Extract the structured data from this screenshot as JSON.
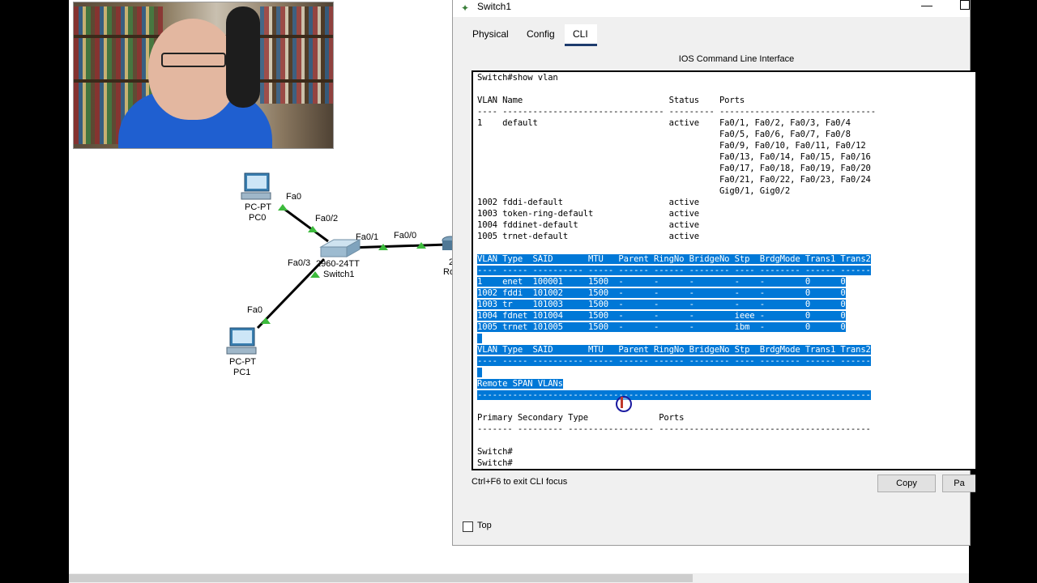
{
  "topology": {
    "pc0": {
      "type": "PC-PT",
      "name": "PC0",
      "port": "Fa0"
    },
    "pc1": {
      "type": "PC-PT",
      "name": "PC1",
      "port": "Fa0"
    },
    "switch": {
      "model": "2960-24TT",
      "name": "Switch1",
      "ports": [
        "Fa0/2",
        "Fa0/1",
        "Fa0/3"
      ]
    },
    "router": {
      "port": "Fa0/0",
      "name_fragment": "2",
      "name_fragment2": "Ro"
    }
  },
  "window": {
    "title": "Switch1",
    "tabs": [
      {
        "label": "Physical"
      },
      {
        "label": "Config"
      },
      {
        "label": "CLI",
        "active": true
      }
    ],
    "cli_caption": "IOS Command Line Interface",
    "footer_hint": "Ctrl+F6 to exit CLI focus",
    "copy_label": "Copy",
    "paste_label": "Pa",
    "top_checkbox_label": "Top",
    "top_checked": false
  },
  "cli_lines": [
    {
      "text": "Switch#show vlan",
      "hl": false
    },
    {
      "text": "",
      "hl": false
    },
    {
      "text": "VLAN Name                             Status    Ports",
      "hl": false
    },
    {
      "text": "---- -------------------------------- --------- -------------------------------",
      "hl": false
    },
    {
      "text": "1    default                          active    Fa0/1, Fa0/2, Fa0/3, Fa0/4",
      "hl": false
    },
    {
      "text": "                                                Fa0/5, Fa0/6, Fa0/7, Fa0/8",
      "hl": false
    },
    {
      "text": "                                                Fa0/9, Fa0/10, Fa0/11, Fa0/12",
      "hl": false
    },
    {
      "text": "                                                Fa0/13, Fa0/14, Fa0/15, Fa0/16",
      "hl": false
    },
    {
      "text": "                                                Fa0/17, Fa0/18, Fa0/19, Fa0/20",
      "hl": false
    },
    {
      "text": "                                                Fa0/21, Fa0/22, Fa0/23, Fa0/24",
      "hl": false
    },
    {
      "text": "                                                Gig0/1, Gig0/2",
      "hl": false
    },
    {
      "text": "1002 fddi-default                     active",
      "hl": false
    },
    {
      "text": "1003 token-ring-default               active",
      "hl": false
    },
    {
      "text": "1004 fddinet-default                  active",
      "hl": false
    },
    {
      "text": "1005 trnet-default                    active",
      "hl": false
    },
    {
      "text": "",
      "hl": false
    },
    {
      "text": "VLAN Type  SAID       MTU   Parent RingNo BridgeNo Stp  BrdgMode Trans1 Trans2",
      "hl": true
    },
    {
      "text": "---- ----- ---------- ----- ------ ------ -------- ---- -------- ------ ------",
      "hl": true
    },
    {
      "text": "1    enet  100001     1500  -      -      -        -    -        0      0",
      "hl": true
    },
    {
      "text": "1002 fddi  101002     1500  -      -      -        -    -        0      0",
      "hl": true
    },
    {
      "text": "1003 tr    101003     1500  -      -      -        -    -        0      0",
      "hl": true
    },
    {
      "text": "1004 fdnet 101004     1500  -      -      -        ieee -        0      0",
      "hl": true
    },
    {
      "text": "1005 trnet 101005     1500  -      -      -        ibm  -        0      0",
      "hl": true
    },
    {
      "text": " ",
      "hl": true
    },
    {
      "text": "VLAN Type  SAID       MTU   Parent RingNo BridgeNo Stp  BrdgMode Trans1 Trans2",
      "hl": true
    },
    {
      "text": "---- ----- ---------- ----- ------ ------ -------- ---- -------- ------ ------",
      "hl": true
    },
    {
      "text": " ",
      "hl": true
    },
    {
      "text": "Remote SPAN VLANs",
      "hl": true
    },
    {
      "text": "------------------------------------------------------------------------------",
      "hl": true
    },
    {
      "text": "",
      "hl": false
    },
    {
      "text": "Primary Secondary Type              Ports",
      "hl": false
    },
    {
      "text": "------- --------- ----------------- ------------------------------------------",
      "hl": false
    },
    {
      "text": "",
      "hl": false
    },
    {
      "text": "Switch#",
      "hl": false
    },
    {
      "text": "Switch#",
      "hl": false
    },
    {
      "text": "Switch#",
      "hl": false
    }
  ]
}
